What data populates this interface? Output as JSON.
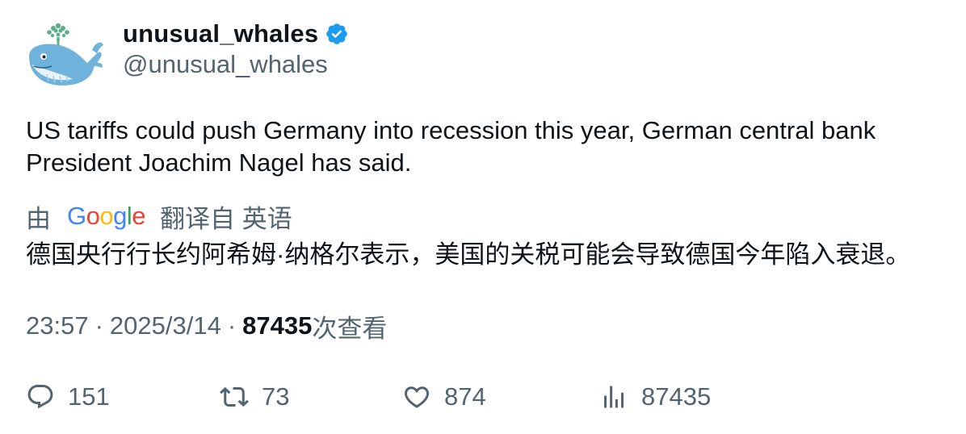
{
  "author": {
    "display_name": "unusual_whales",
    "handle": "@unusual_whales",
    "verified": true,
    "avatar_icon": "whale-avatar-icon",
    "verified_icon": "verified-badge-icon",
    "verified_color": "#1d9bf0"
  },
  "tweet": {
    "text": "US tariffs could push Germany into recession this year, German central bank President Joachim Nagel has said."
  },
  "translation": {
    "prefix": "由",
    "provider": "Google",
    "suffix": "翻译自 英语",
    "text": "德国央行行长约阿希姆·纳格尔表示，美国的关税可能会导致德国今年陷入衰退。"
  },
  "meta": {
    "time": "23:57",
    "date": "2025/3/14",
    "separator": "·",
    "views_count": "87435",
    "views_label": "次查看"
  },
  "actions": {
    "reply": {
      "icon": "reply-icon",
      "count": "151"
    },
    "retweet": {
      "icon": "retweet-icon",
      "count": "73"
    },
    "like": {
      "icon": "heart-icon",
      "count": "874"
    },
    "views": {
      "icon": "views-chart-icon",
      "count": "87435"
    }
  },
  "colors": {
    "text_primary": "#0f1419",
    "text_secondary": "#536471",
    "accent": "#1d9bf0"
  }
}
